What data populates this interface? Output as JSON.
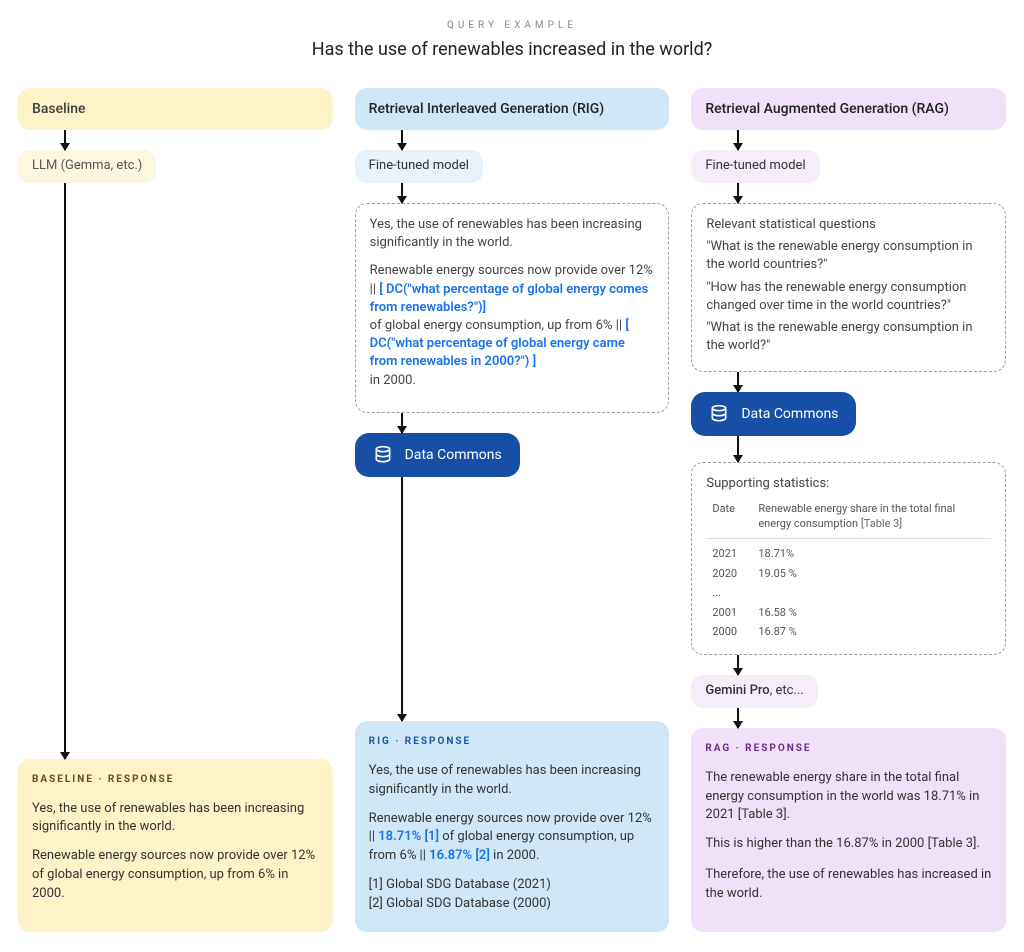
{
  "header": {
    "eyebrow": "QUERY EXAMPLE",
    "title": "Has the use of renewables increased in the world?"
  },
  "baseline": {
    "label": "Baseline",
    "model": "LLM (Gemma, etc.)",
    "response_label": "BASELINE · RESPONSE",
    "response": {
      "p1": "Yes, the use of renewables has been increasing significantly in the world.",
      "p2": "Renewable energy sources now provide over 12% of global energy consumption, up from 6%  in 2000."
    }
  },
  "rig": {
    "label": "Retrieval Interleaved Generation (RIG)",
    "model": "Fine-tuned model",
    "intermediate": {
      "p1": "Yes, the use of renewables has been increasing significantly in the world.",
      "p2a": "Renewable energy sources now provide over 12% || ",
      "dc1": "[ DC(\"what percentage of global energy comes from renewables?\")]",
      "p2b": "of global energy consumption, up from 6% || ",
      "dc2": "[ DC(\"what percentage of global energy came from renewables in 2000?\") ]",
      "p2c": "in 2000."
    },
    "dc_label": "Data Commons",
    "response_label": "RIG · RESPONSE",
    "response": {
      "p1": "Yes, the use of renewables has been increasing significantly in the world.",
      "p2a": "Renewable energy sources now provide over 12% || ",
      "cite1": "18.71% [1]",
      "p2b": " of global energy consumption, up from 6% || ",
      "cite2": "16.87% [2]",
      "p2c": " in 2000.",
      "ref1": "[1]  Global SDG Database (2021)",
      "ref2": "[2] Global SDG Database (2000)"
    }
  },
  "rag": {
    "label": "Retrieval Augmented Generation (RAG)",
    "model": "Fine-tuned model",
    "questions": {
      "heading": "Relevant statistical questions",
      "q1": "\"What is the renewable energy consumption in the world countries?\"",
      "q2": "\"How has the renewable energy consumption changed over time in the world countries?\"",
      "q3": "\"What is the renewable energy consumption in the world?\""
    },
    "dc_label": "Data Commons",
    "stats": {
      "heading": "Supporting statistics:",
      "col_date": "Date",
      "col_metric": "Renewable energy share in the total final energy consumption",
      "col_ref": "[Table 3]",
      "rows": [
        {
          "date": "2021",
          "val": "18.71%"
        },
        {
          "date": "2020",
          "val": "19.05 %"
        },
        {
          "date": "...",
          "val": ""
        },
        {
          "date": "2001",
          "val": "16.58 %"
        },
        {
          "date": "2000",
          "val": "16.87 %"
        }
      ]
    },
    "gemini": "Gemini Pro",
    "gemini_suffix": ", etc...",
    "response_label": "RAG · RESPONSE",
    "response": {
      "p1": "The renewable energy share in the total final energy consumption in the world was 18.71% in 2021 [Table 3].",
      "p2": "This is higher than the 16.87% in 2000 [Table 3].",
      "p3": "Therefore, the use of renewables has increased in the world."
    }
  }
}
